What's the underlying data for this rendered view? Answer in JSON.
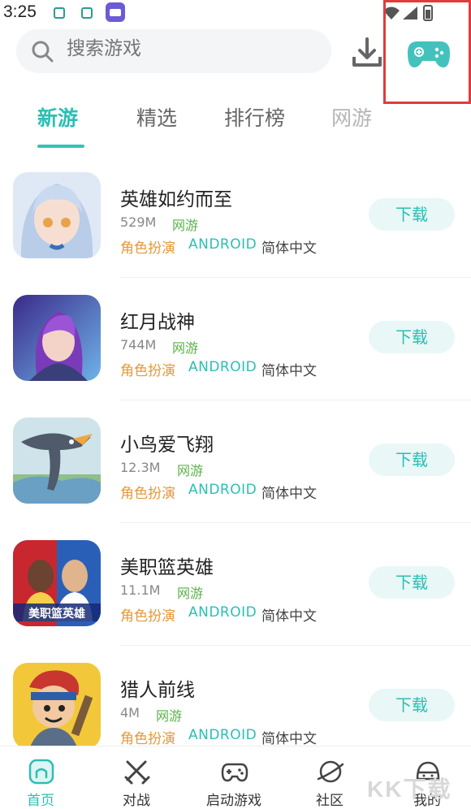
{
  "status_bar": {
    "time": "3:25"
  },
  "search": {
    "placeholder": "搜索游戏"
  },
  "tabs": [
    {
      "label": "新游",
      "active": true
    },
    {
      "label": "精选",
      "active": false
    },
    {
      "label": "排行榜",
      "active": false
    },
    {
      "label": "网游",
      "active": false
    }
  ],
  "games": [
    {
      "title": "英雄如约而至",
      "size": "529M",
      "category": "网游",
      "genre": "角色扮演",
      "platform": "ANDROID",
      "language": "简体中文",
      "button": "下载"
    },
    {
      "title": "红月战神",
      "size": "744M",
      "category": "网游",
      "genre": "角色扮演",
      "platform": "ANDROID",
      "language": "简体中文",
      "button": "下载"
    },
    {
      "title": "小鸟爱飞翔",
      "size": "12.3M",
      "category": "网游",
      "genre": "角色扮演",
      "platform": "ANDROID",
      "language": "简体中文",
      "button": "下载"
    },
    {
      "title": "美职篮英雄",
      "size": "11.1M",
      "category": "网游",
      "genre": "角色扮演",
      "platform": "ANDROID",
      "language": "简体中文",
      "button": "下载",
      "icon_text": "美职篮英雄"
    },
    {
      "title": "猎人前线",
      "size": "4M",
      "category": "网游",
      "genre": "角色扮演",
      "platform": "ANDROID",
      "language": "简体中文",
      "button": "下载"
    }
  ],
  "bottom_nav": [
    {
      "label": "首页",
      "icon": "home-icon",
      "active": true
    },
    {
      "label": "对战",
      "icon": "crossed-swords-icon",
      "active": false
    },
    {
      "label": "启动游戏",
      "icon": "gamepad-icon",
      "active": false
    },
    {
      "label": "社区",
      "icon": "planet-icon",
      "active": false
    },
    {
      "label": "我的",
      "icon": "face-icon",
      "active": false
    }
  ],
  "watermark": "KK下载",
  "colors": {
    "accent": "#2bbfb3",
    "genre": "#e4983a",
    "category": "#5bb24a",
    "highlight_box": "#e23b3b"
  }
}
